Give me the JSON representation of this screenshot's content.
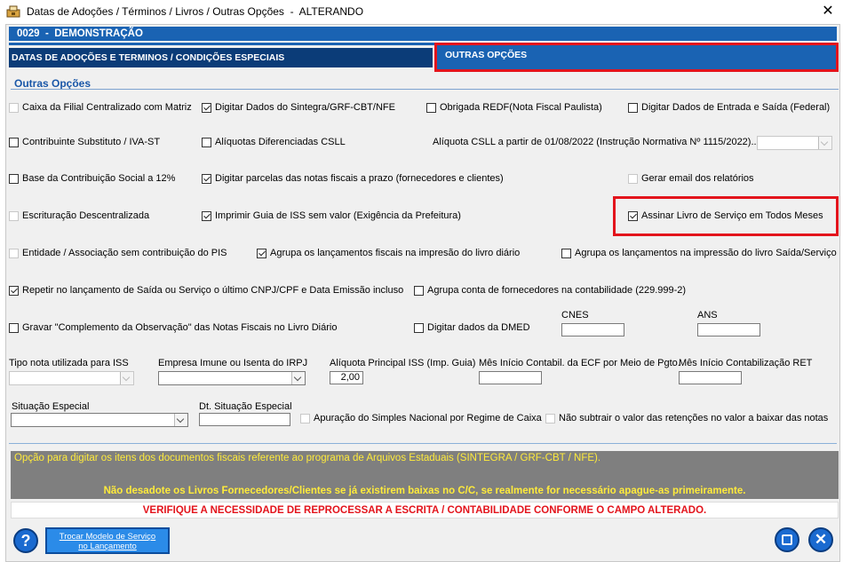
{
  "window": {
    "title": "Datas de Adoções / Términos / Livros / Outras Opções  -  ALTERANDO",
    "close_label": "✕"
  },
  "company": {
    "code": "0029",
    "separator": "-",
    "name": "DEMONSTRAÇÃO"
  },
  "tabs": {
    "dates": "DATAS DE ADOÇÕES E TERMINOS / CONDIÇÕES ESPECIAIS",
    "other": "OUTRAS OPÇÕES"
  },
  "section_title": "Outras Opções",
  "checkboxes": {
    "caixa_filial": {
      "label": "Caixa da Filial Centralizado com Matriz",
      "checked": false,
      "enabled": false
    },
    "digitar_sintegra": {
      "label": "Digitar Dados do Sintegra/GRF-CBT/NFE",
      "checked": true,
      "enabled": true
    },
    "obrigada_redf": {
      "label": "Obrigada REDF(Nota Fiscal Paulista)",
      "checked": false,
      "enabled": true
    },
    "digitar_entrada_saida": {
      "label": "Digitar Dados de Entrada e Saída (Federal)",
      "checked": false,
      "enabled": true
    },
    "contribuinte_substituto": {
      "label": "Contribuinte Substituto / IVA-ST",
      "checked": false,
      "enabled": true
    },
    "aliquotas_csll": {
      "label": "Alíquotas Diferenciadas CSLL",
      "checked": false,
      "enabled": true
    },
    "base_contribuicao": {
      "label": "Base da Contribuição Social a 12%",
      "checked": false,
      "enabled": true
    },
    "digitar_parcelas": {
      "label": "Digitar parcelas das notas fiscais a prazo (fornecedores e clientes)",
      "checked": true,
      "enabled": true
    },
    "gerar_email": {
      "label": "Gerar email dos relatórios",
      "checked": false,
      "enabled": false
    },
    "escrituracao_descentralizada": {
      "label": "Escrituração Descentralizada",
      "checked": false,
      "enabled": false
    },
    "imprimir_guia_iss": {
      "label": "Imprimir Guia de ISS sem valor (Exigência da Prefeitura)",
      "checked": true,
      "enabled": true
    },
    "assinar_livro": {
      "label": "Assinar Livro de Serviço em Todos Meses",
      "checked": true,
      "enabled": true
    },
    "entidade_associacao": {
      "label": "Entidade / Associação sem contribuição do PIS",
      "checked": false,
      "enabled": false
    },
    "agrupa_livro_diario": {
      "label": "Agrupa os lançamentos fiscais na impresão do livro diário",
      "checked": true,
      "enabled": true
    },
    "agrupa_saida_servico": {
      "label": "Agrupa os lançamentos na impressão do livro Saída/Serviço",
      "checked": false,
      "enabled": true
    },
    "repetir_lancamento": {
      "label": "Repetir no lançamento de Saída ou Serviço o último CNPJ/CPF e Data Emissão incluso",
      "checked": true,
      "enabled": true
    },
    "agrupa_fornecedores": {
      "label": "Agrupa conta de fornecedores na contabilidade (229.999-2)",
      "checked": false,
      "enabled": true
    },
    "gravar_complemento": {
      "label": "Gravar \"Complemento da Observação\" das Notas Fiscais no Livro Diário",
      "checked": false,
      "enabled": true
    },
    "digitar_dmed": {
      "label": "Digitar dados da DMED",
      "checked": false,
      "enabled": true
    },
    "apuracao_simples": {
      "label": "Apuração do Simples Nacional por Regime de Caixa",
      "checked": false,
      "enabled": false
    },
    "nao_subtrair": {
      "label": "Não subtrair o valor das retenções no valor a baixar das notas",
      "checked": false,
      "enabled": false
    }
  },
  "fields": {
    "aliquota_csll_label": "Alíquota CSLL a partir de 01/08/2022 (Instrução Normativa Nº 1115/2022)..:",
    "cnes_label": "CNES",
    "ans_label": "ANS",
    "tipo_nota_label": "Tipo nota utilizada para ISS",
    "empresa_imune_label": "Empresa Imune ou Isenta do IRPJ",
    "aliquota_iss_label": "Alíquota Principal ISS (Imp. Guia)",
    "aliquota_iss_value": "2,00",
    "mes_ecf_label": "Mês Início Contabil. da ECF por Meio de Pgto.",
    "mes_ret_label": "Mês Início Contabilização RET",
    "situacao_especial_label": "Situação Especial",
    "dt_situacao_label": "Dt. Situação Especial"
  },
  "messages": {
    "info": "Opção para digitar os itens dos documentos fiscais referente ao programa de Arquivos Estaduais (SINTEGRA / GRF-CBT / NFE).",
    "warning": "Não desadote os Livros Fornecedores/Clientes se já existirem baixas no C/C, se realmente for necessário apague-as primeiramente.",
    "alert": "VERIFIQUE A NECESSIDADE DE REPROCESSAR A ESCRITA / CONTABILIDADE CONFORME O CAMPO ALTERADO."
  },
  "buttons": {
    "help": "?",
    "swap_line1": "Trocar Modelo de Serviço",
    "swap_line2": "no Lançamento",
    "exit": "✕"
  },
  "colors": {
    "accent": "#1a63b3",
    "dark_tab": "#0b3c78",
    "highlight": "#e3141c",
    "info_bg": "#7f7f7f",
    "info_text": "#ffeb3b",
    "alert_text": "#e3141c"
  }
}
